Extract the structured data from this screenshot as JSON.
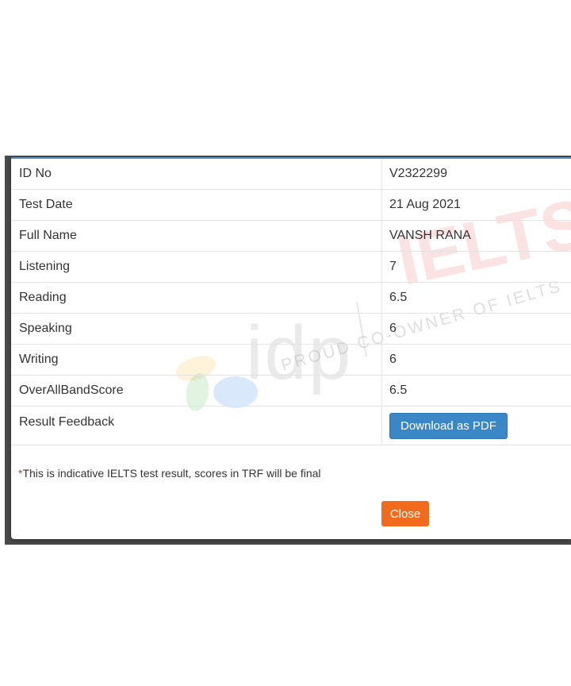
{
  "results": [
    {
      "label": "ID No",
      "value": "V2322299"
    },
    {
      "label": "Test Date",
      "value": "21 Aug 2021"
    },
    {
      "label": "Full Name",
      "value": "VANSH RANA"
    },
    {
      "label": "Listening",
      "value": "7"
    },
    {
      "label": "Reading",
      "value": "6.5"
    },
    {
      "label": "Speaking",
      "value": "6"
    },
    {
      "label": "Writing",
      "value": "6"
    },
    {
      "label": "OverAllBandScore",
      "value": "6.5"
    }
  ],
  "feedback": {
    "label": "Result Feedback",
    "download_label": "Download as PDF"
  },
  "note": {
    "star": "*",
    "text": "This is indicative IELTS test result, scores in TRF will be final"
  },
  "close_label": "Close",
  "watermark": {
    "brand": "idp",
    "product": "IELTS",
    "tagline": "PROUD CO-OWNER OF IELTS"
  },
  "colors": {
    "primary_button": "#3a87c8",
    "close_button": "#f26a1b",
    "note_star": "#c0392b"
  }
}
